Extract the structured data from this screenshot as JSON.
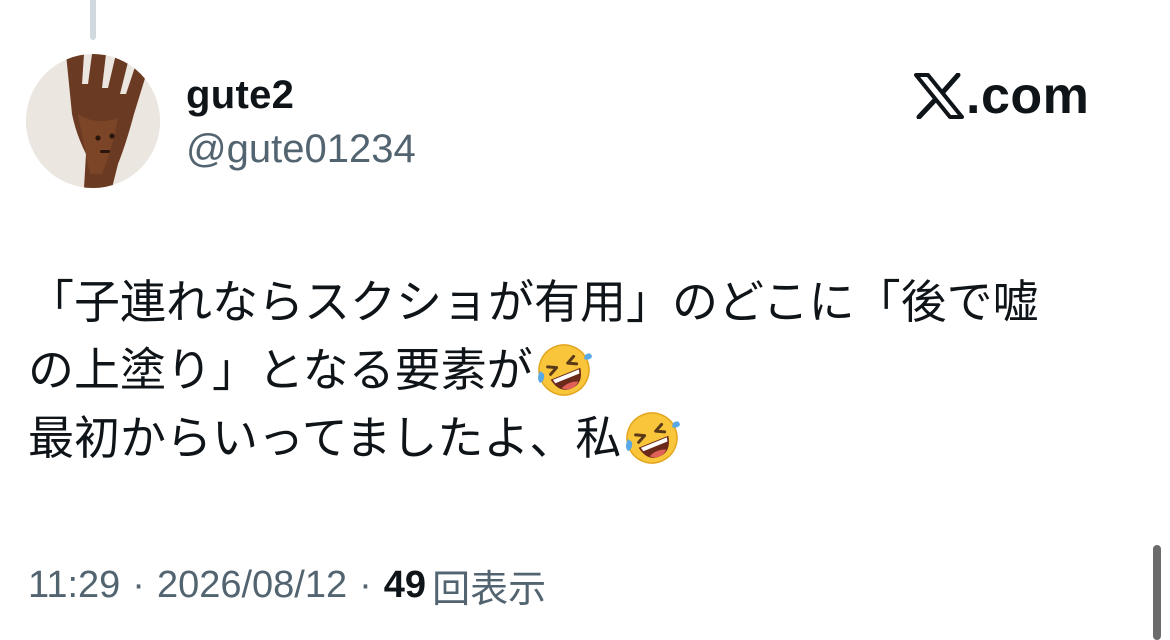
{
  "author": {
    "display_name": "gute2",
    "handle": "@gute01234"
  },
  "brand": {
    "logo": "x-logo-icon",
    "text": ".com"
  },
  "tweet": {
    "lines": [
      "「子連れならスクショが有用」のどこに「後で嘘",
      "の上塗り」となる要素が",
      "最初からいってましたよ、私"
    ],
    "emoji": "rolling-on-the-floor-laughing-icon"
  },
  "meta": {
    "time": "11:29",
    "separator": "·",
    "date": "2026/08/12",
    "views_count": "49",
    "views_label": "回表示"
  },
  "colors": {
    "text_primary": "#0f1419",
    "text_secondary": "#536471",
    "thread_line": "#cfd9de"
  }
}
